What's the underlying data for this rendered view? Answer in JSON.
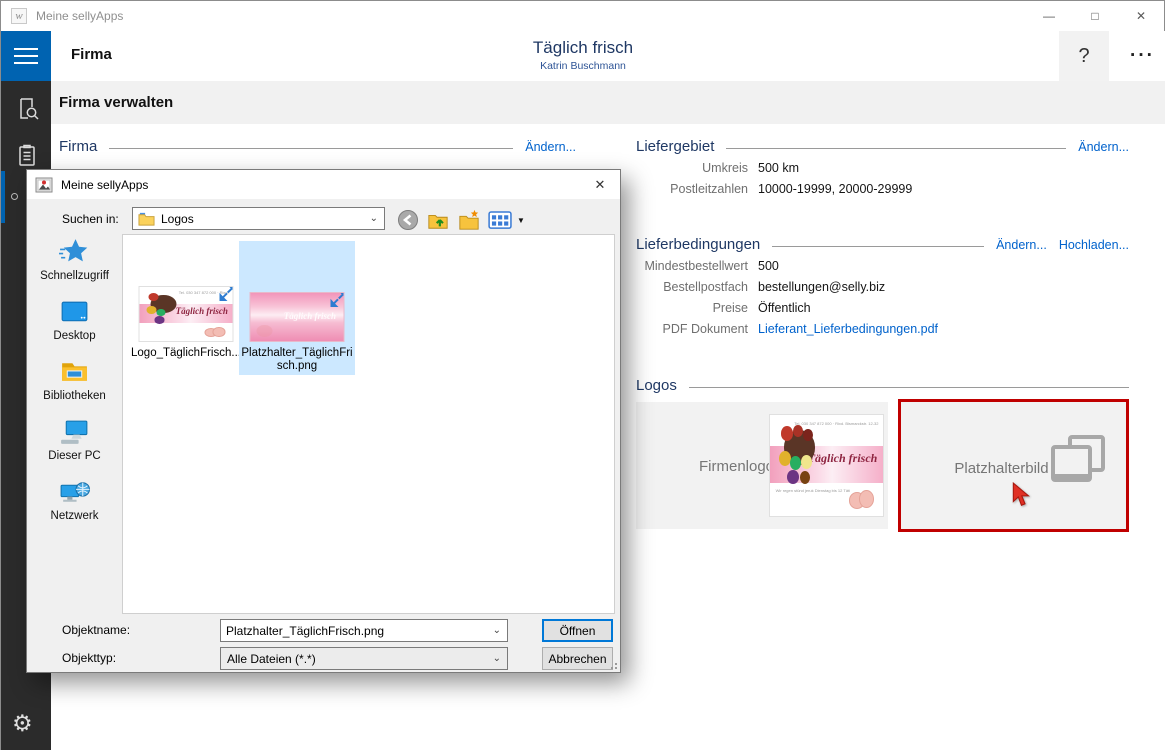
{
  "window": {
    "title": "Meine sellyApps",
    "icon_letter": "w",
    "minimize": "—",
    "maximize": "□",
    "close": "✕"
  },
  "appbar": {
    "page_title": "Firma",
    "company": "Täglich frisch",
    "user": "Katrin Buschmann",
    "help": "?",
    "more": "···",
    "section_title": "Firma verwalten"
  },
  "main": {
    "firma": {
      "title": "Firma",
      "change_link": "Ändern..."
    },
    "liefergebiet": {
      "title": "Liefergebiet",
      "change_link": "Ändern...",
      "rows": [
        {
          "label": "Umkreis",
          "value": "500 km"
        },
        {
          "label": "Postleitzahlen",
          "value": "10000-19999, 20000-29999"
        }
      ]
    },
    "lieferbedingungen": {
      "title": "Lieferbedingungen",
      "change_link": "Ändern...",
      "upload_link": "Hochladen...",
      "rows": [
        {
          "label": "Mindestbestellwert",
          "value": "500"
        },
        {
          "label": "Bestellpostfach",
          "value": "bestellungen@selly.biz"
        },
        {
          "label": "Preise",
          "value": "Öffentlich"
        },
        {
          "label": "PDF Dokument",
          "value": "Lieferant_Lieferbedingungen.pdf"
        }
      ]
    },
    "logos": {
      "title": "Logos",
      "firmenlogo_label": "Firmenlogo",
      "platzhalter_label": "Platzhalterbild",
      "logo_script_text": "Täglich frisch"
    }
  },
  "dialog": {
    "title": "Meine sellyApps",
    "close": "✕",
    "look_in_label": "Suchen in:",
    "look_in_value": "Logos",
    "places": [
      {
        "label": "Schnellzugriff"
      },
      {
        "label": "Desktop"
      },
      {
        "label": "Bibliotheken"
      },
      {
        "label": "Dieser PC"
      },
      {
        "label": "Netzwerk"
      }
    ],
    "files": [
      {
        "name": "Logo_TäglichFrisch...",
        "selected": false
      },
      {
        "name": "Platzhalter_TäglichFrisch.png",
        "selected": true
      }
    ],
    "objektname_label": "Objektname:",
    "objektname_value": "Platzhalter_TäglichFrisch.png",
    "objekttyp_label": "Objekttyp:",
    "objekttyp_value": "Alle Dateien (*.*)",
    "open_button": "Öffnen",
    "cancel_button": "Abbrechen"
  },
  "colors": {
    "accent_blue": "#0063B1",
    "link_blue": "#0062CC",
    "heading_blue": "#1F3864",
    "selection_blue": "#CCE8FF",
    "highlight_red": "#C00000",
    "open_button_border": "#0078D7"
  }
}
